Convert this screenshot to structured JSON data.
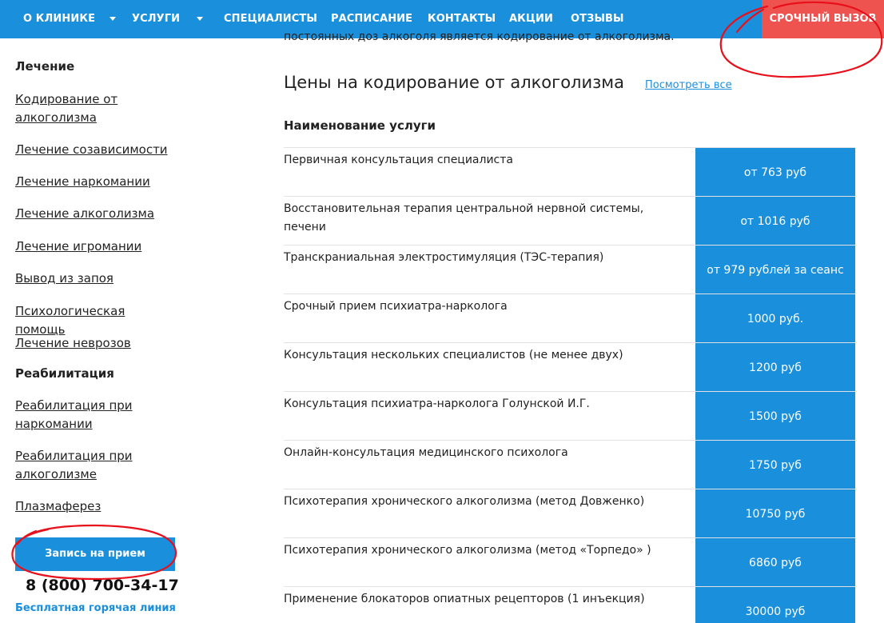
{
  "nav": {
    "items": [
      {
        "label": "О КЛИНИКЕ",
        "dropdown": true
      },
      {
        "label": "УСЛУГИ",
        "dropdown": true
      },
      {
        "label": "СПЕЦИАЛИСТЫ",
        "dropdown": false
      },
      {
        "label": "РАСПИСАНИЕ",
        "dropdown": false
      },
      {
        "label": "КОНТАКТЫ",
        "dropdown": false
      },
      {
        "label": "АКЦИИ",
        "dropdown": false
      },
      {
        "label": "ОТЗЫВЫ",
        "dropdown": false
      }
    ],
    "urgent_label": "СРОЧНЫЙ ВЫЗОВ"
  },
  "cut_paragraph": "постоянных доз алкоголя является кодирование от алкоголизма.",
  "sidebar": {
    "treatment_heading": "Лечение",
    "treatment_links": [
      "Кодирование от алкоголизма",
      "Лечение созависимости",
      "Лечение наркомании",
      "Лечение алкоголизма",
      "Лечение игромании",
      "Вывод из запоя",
      "Психологическая помощь",
      "Лечение неврозов"
    ],
    "rehab_heading": "Реабилитация",
    "rehab_links": [
      "Реабилитация при наркомании",
      "Реабилитация при алкоголизме",
      "Плазмаферез"
    ],
    "appointment_button": "Запись на прием",
    "phone": "8 (800) 700-34-17",
    "hotline": "Бесплатная горячая линия"
  },
  "main": {
    "title": "Цены на кодирование от алкоголизма",
    "see_all": "Посмотреть все",
    "column_header": "Наименование услуги",
    "rows": [
      {
        "service": "Первичная консультация специалиста",
        "price": "от 763 руб"
      },
      {
        "service": "Восстановительная терапия центральной нервной системы, печени",
        "price": "от 1016 руб"
      },
      {
        "service": "Транскраниальная электростимуляция (ТЭС-терапия)",
        "price": "от 979 рублей за сеанс"
      },
      {
        "service": "Срочный прием психиатра-нарколога",
        "price": "1000 руб."
      },
      {
        "service": "Консультация нескольких специалистов (не менее двух)",
        "price": "1200 руб"
      },
      {
        "service": "Консультация психиатра-нарколога Голунской И.Г.",
        "price": "1500 руб"
      },
      {
        "service": "Онлайн-консультация медицинского психолога",
        "price": "1750 руб"
      },
      {
        "service": "Психотерапия хронического алкоголизма (метод Довженко)",
        "price": "10750 руб"
      },
      {
        "service": "Психотерапия хронического алкоголизма (метод «Торпедо» )",
        "price": "6860 руб"
      },
      {
        "service": "Применение блокаторов опиатных рецепторов (1 инъекция)",
        "price": "30000 руб"
      }
    ]
  },
  "colors": {
    "brand_blue": "#1a8fdc",
    "urgent_red": "#ef5350",
    "annotation_red": "#e8101a"
  }
}
